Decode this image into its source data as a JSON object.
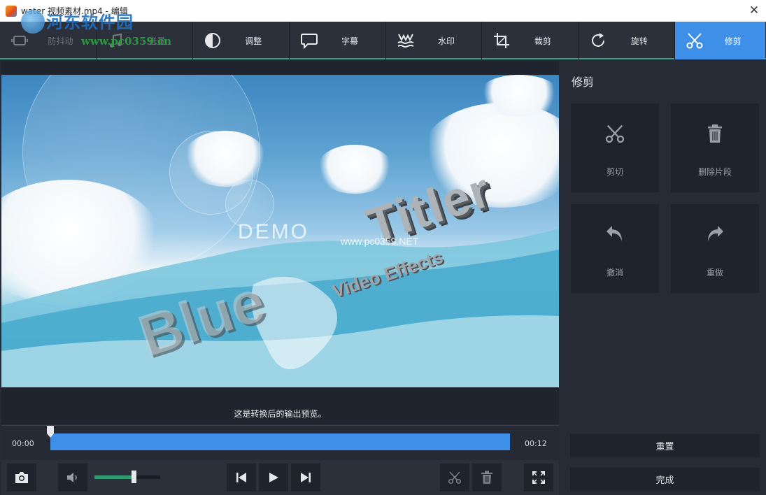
{
  "window": {
    "title": "water 视频素材.mp4 - 编辑",
    "close_label": "✕"
  },
  "watermark": {
    "site_name": "河东软件园",
    "site_url": "www.pc0359.cn"
  },
  "toolbar": {
    "tabs": [
      {
        "label": "防抖动",
        "icon": "stabilize-icon",
        "state": "disabled"
      },
      {
        "label": "音量",
        "icon": "music-note-icon",
        "state": "disabled"
      },
      {
        "label": "调整",
        "icon": "contrast-icon",
        "state": "normal"
      },
      {
        "label": "字幕",
        "icon": "speech-bubble-icon",
        "state": "normal"
      },
      {
        "label": "水印",
        "icon": "watermark-icon",
        "state": "normal"
      },
      {
        "label": "裁剪",
        "icon": "crop-icon",
        "state": "normal"
      },
      {
        "label": "旋转",
        "icon": "rotate-icon",
        "state": "normal"
      },
      {
        "label": "修剪",
        "icon": "scissors-icon",
        "state": "active"
      }
    ]
  },
  "preview": {
    "demo_text": "DEMO",
    "demo_sub": "www.pc0359.NET",
    "title_main": "Titler",
    "title_sub": "Video Effects",
    "title_blur": "Blue",
    "caption": "这是转换后的输出预览。"
  },
  "timeline": {
    "start_time": "00:00",
    "end_time": "00:12",
    "playhead_fraction": 0.0
  },
  "controls": {
    "snapshot": "camera-icon",
    "volume_icon": "speaker-icon",
    "volume_level": 0.6,
    "prev": "skip-previous-icon",
    "play": "play-icon",
    "next": "skip-next-icon",
    "cut": "scissors-icon",
    "delete": "trash-icon",
    "fullscreen": "fullscreen-icon"
  },
  "sidepanel": {
    "title": "修剪",
    "tiles": [
      {
        "label": "剪切",
        "icon": "scissors-icon"
      },
      {
        "label": "删除片段",
        "icon": "trash-icon"
      },
      {
        "label": "撤消",
        "icon": "undo-icon"
      },
      {
        "label": "重做",
        "icon": "redo-icon"
      }
    ],
    "reset_label": "重置",
    "done_label": "完成"
  },
  "colors": {
    "accent": "#3d8fe8",
    "toolbar_bg": "#2b303a",
    "panel_bg": "#262b36",
    "tile_bg": "#1f232c",
    "volume_fill": "#2e9a6e",
    "toolbar_border": "#3d9e8f"
  }
}
